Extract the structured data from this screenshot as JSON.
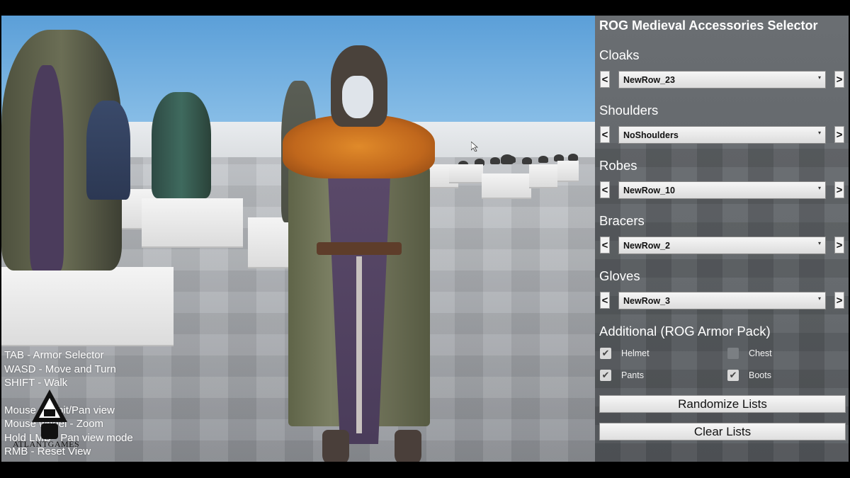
{
  "panel": {
    "title": "ROG Medieval Accessories Selector",
    "sections": [
      {
        "label": "Cloaks",
        "value": "NewRow_23"
      },
      {
        "label": "Shoulders",
        "value": "NoShoulders"
      },
      {
        "label": "Robes",
        "value": "NewRow_10"
      },
      {
        "label": "Bracers",
        "value": "NewRow_2"
      },
      {
        "label": "Gloves",
        "value": "NewRow_3"
      }
    ],
    "prev_glyph": "<",
    "next_glyph": ">",
    "dropdown_glyph": "▾",
    "additional": {
      "label": "Additional (ROG Armor Pack)",
      "options": [
        {
          "label": "Helmet",
          "checked": true
        },
        {
          "label": "Chest",
          "checked": false
        },
        {
          "label": "Pants",
          "checked": true
        },
        {
          "label": "Boots",
          "checked": true
        }
      ],
      "check_glyph": "✔"
    },
    "randomize_label": "Randomize Lists",
    "clear_label": "Clear Lists"
  },
  "help": {
    "lines": [
      "TAB - Armor Selector",
      "WASD - Move and Turn",
      "SHIFT - Walk"
    ],
    "lines2": [
      "Mouse - Orbit/Pan view",
      "Mouse wheel - Zoom",
      "Hold LMB - Pan view mode",
      "RMB - Reset View"
    ]
  },
  "logo": {
    "text": "ATLANTGAMES",
    "icon": "atlant-games-logo-icon"
  },
  "colors": {
    "panel": "#6a6e72",
    "accent_fur": "#c0671c",
    "sky": "#5b9fd8"
  }
}
